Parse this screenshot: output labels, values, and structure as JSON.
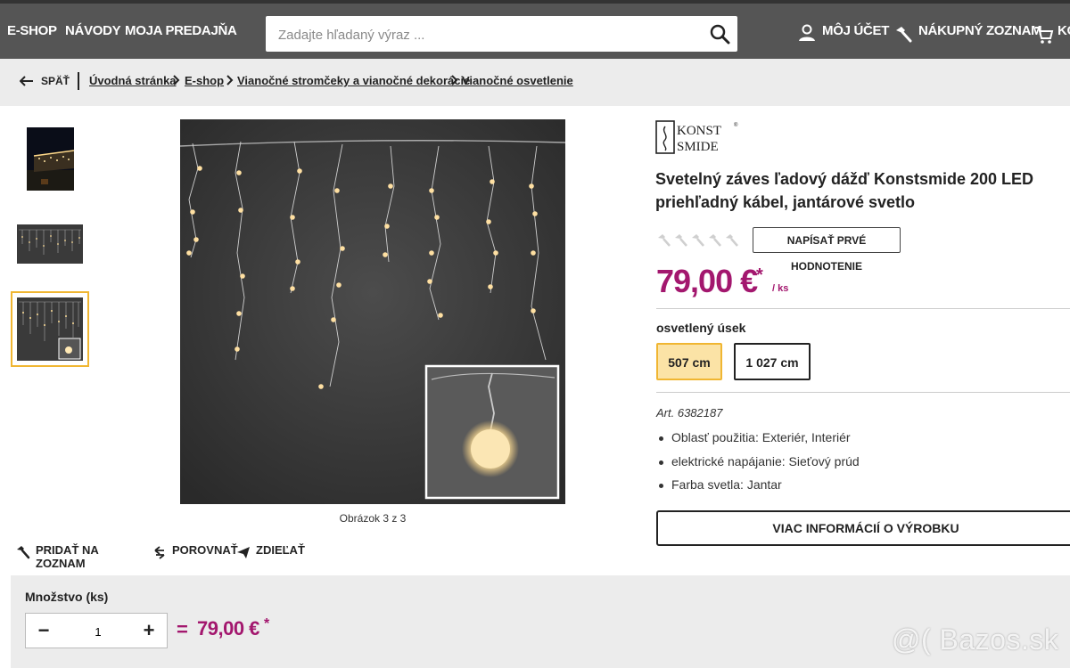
{
  "nav": {
    "items": [
      "E-SHOP",
      "NÁVODY",
      "MOJA PREDAJŇA"
    ],
    "search_placeholder": "Zadajte hľadaný výraz ...",
    "account": "MÔJ ÚČET",
    "shopping_list": "NÁKUPNÝ ZOZNAM",
    "cart": "KO"
  },
  "breadcrumb": {
    "back": "SPÄŤ",
    "items": [
      "Úvodná stránka",
      "E-shop",
      "Vianočné stromčeky a vianočné dekorácie",
      "Vianočné osvetlenie"
    ]
  },
  "gallery": {
    "caption": "Obrázok 3 z 3",
    "selected_index": 2,
    "thumbnail_count": 3
  },
  "actions": {
    "add_to_list": "PRIDAŤ NA ZOZNAM",
    "compare": "POROVNAŤ",
    "share": "ZDIEĽAŤ"
  },
  "product": {
    "brand": "KONSTSMIDE",
    "title": "Svetelný záves ľadový dážď Konstsmide 200 LED priehľadný kábel, jantárové svetlo",
    "rating_stars": 0,
    "rating_max": 5,
    "rate_button": "NAPÍSAŤ PRVÉ HODNOTENIE",
    "price": "79,00 €",
    "price_star": "*",
    "price_unit": "/ ks",
    "variant_label": "osvetlený úsek",
    "variants": [
      "507 cm",
      "1 027 cm"
    ],
    "selected_variant": 0,
    "article": "Art. 6382187",
    "features": [
      "Oblasť použitia: Exteriér, Interiér",
      "elektrické napájanie: Sieťový prúd",
      "Farba svetla: Jantar"
    ],
    "more_info": "VIAC INFORMÁCIÍ O VÝROBKU"
  },
  "quantity": {
    "label": "Množstvo (ks)",
    "value": "1",
    "minus": "−",
    "plus": "+",
    "equals": "=",
    "total": "79,00 €",
    "total_star": "*"
  },
  "watermark": "@( Bazos.sk",
  "colors": {
    "accent": "#a3176e",
    "nav_bg": "#555555",
    "variant_selected_bg": "#fbe3a6",
    "variant_selected_border": "#f0b632"
  }
}
